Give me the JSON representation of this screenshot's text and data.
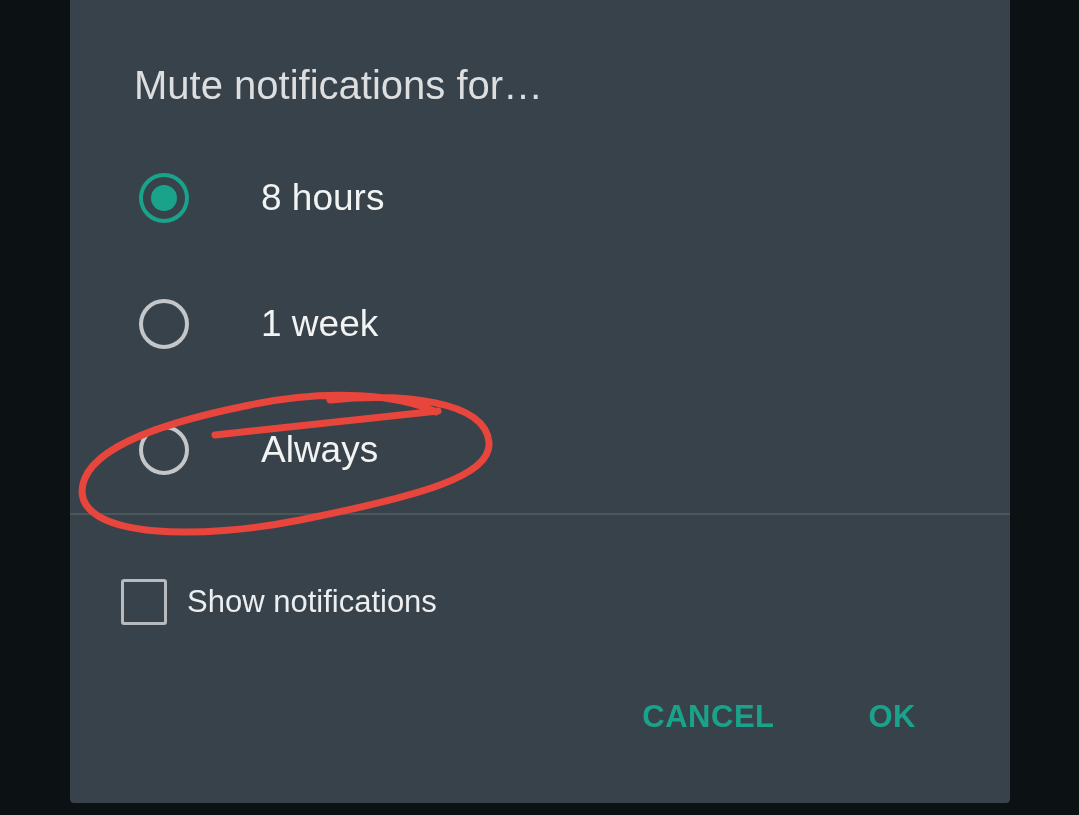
{
  "dialog": {
    "title": "Mute notifications for…",
    "options": [
      {
        "label": "8 hours",
        "selected": true
      },
      {
        "label": "1 week",
        "selected": false
      },
      {
        "label": "Always",
        "selected": false
      }
    ],
    "checkbox": {
      "label": "Show notifications",
      "checked": false
    },
    "buttons": [
      "CANCEL",
      "OK"
    ]
  }
}
